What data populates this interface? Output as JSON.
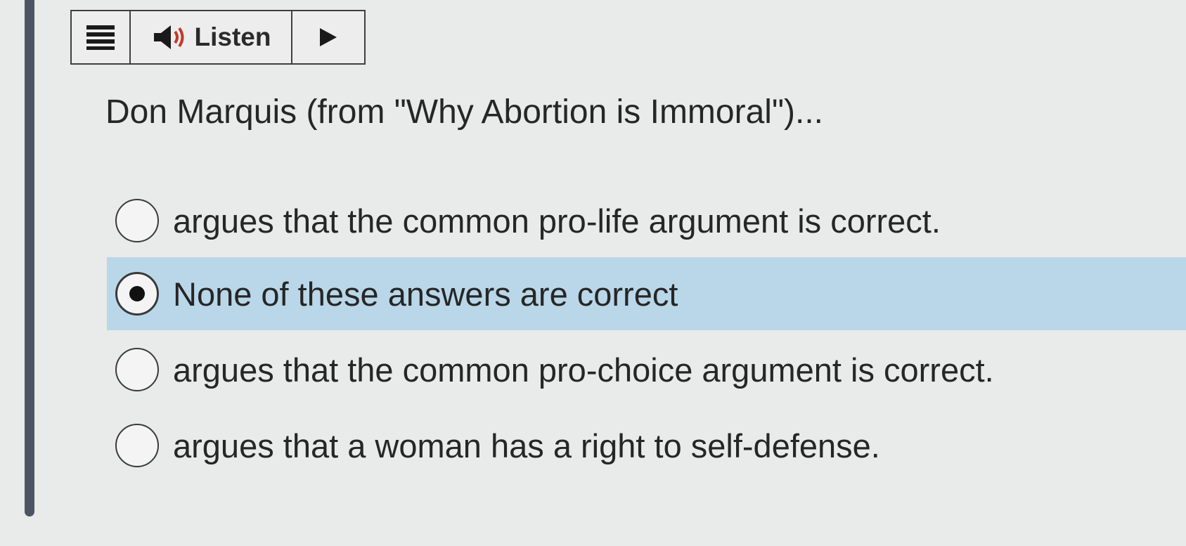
{
  "toolbar": {
    "menu_icon": "hamburger-icon",
    "speaker_icon": "speaker-icon",
    "listen_label": "Listen",
    "play_icon": "play-icon"
  },
  "question": {
    "text": "Don Marquis (from \"Why Abortion is Immoral\")..."
  },
  "options": [
    {
      "label": "argues that the common pro-life argument is correct.",
      "selected": false
    },
    {
      "label": "None of these answers are correct",
      "selected": true
    },
    {
      "label": "argues that the common pro-choice argument is correct.",
      "selected": false
    },
    {
      "label": "argues that a woman has a right to self-defense.",
      "selected": false
    }
  ],
  "colors": {
    "selected_bg": "#b9d7e8",
    "rail": "#4c5563",
    "speaker_red": "#c0392b"
  }
}
